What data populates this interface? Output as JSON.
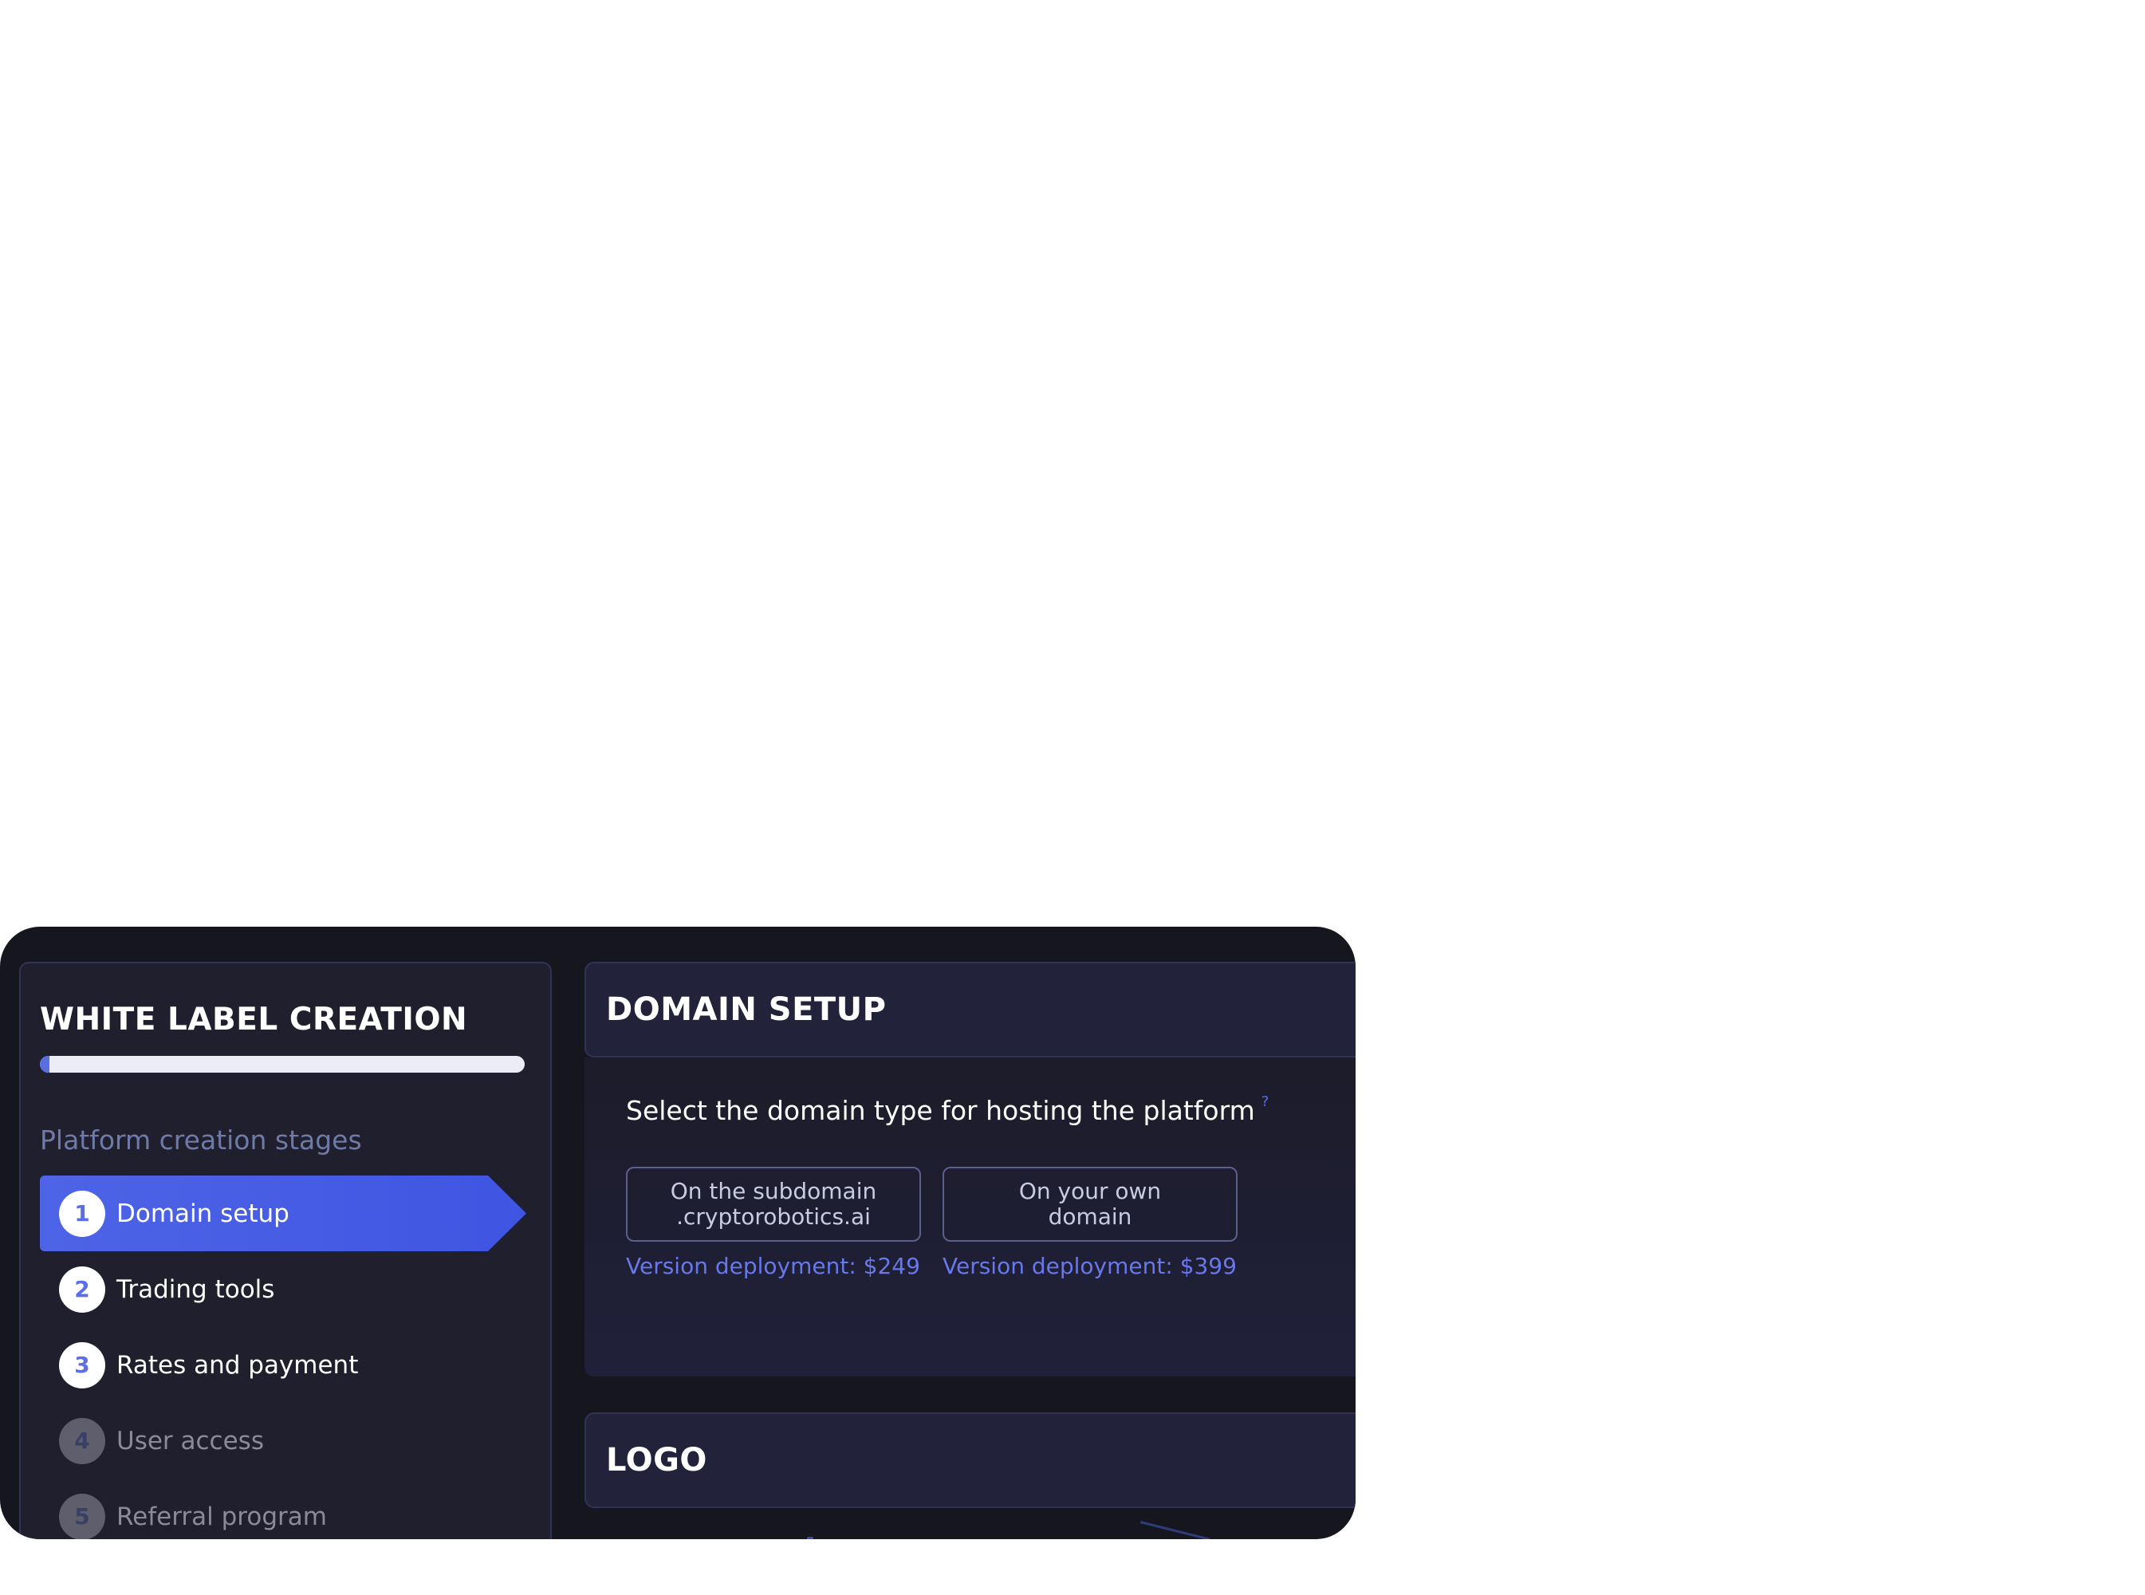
{
  "sidebar": {
    "title": "WHITE LABEL CREATION",
    "progress_fraction": 0.02,
    "stages_label": "Platform creation stages",
    "steps": [
      {
        "number": "1",
        "label": "Domain setup",
        "state": "active"
      },
      {
        "number": "2",
        "label": "Trading tools",
        "state": "available"
      },
      {
        "number": "3",
        "label": "Rates and payment",
        "state": "available"
      },
      {
        "number": "4",
        "label": "User access",
        "state": "disabled"
      },
      {
        "number": "5",
        "label": "Referral program",
        "state": "disabled"
      }
    ]
  },
  "domain_setup": {
    "title": "DOMAIN SETUP",
    "question": "Select the domain type for hosting the platform",
    "help_symbol": "?",
    "options": [
      {
        "line1": "On the subdomain",
        "line2": ".cryptorobotics.ai",
        "price": "Version deployment: $249"
      },
      {
        "line1": "On your own",
        "line2": "domain",
        "price": "Version deployment: $399"
      }
    ]
  },
  "logo_section": {
    "title": "LOGO"
  },
  "colors": {
    "accent": "#4e64e6",
    "price_text": "#6878ea",
    "panel_border": "#2f3356",
    "background": "#16161f"
  },
  "icons": {
    "help": "question-mark-icon"
  }
}
